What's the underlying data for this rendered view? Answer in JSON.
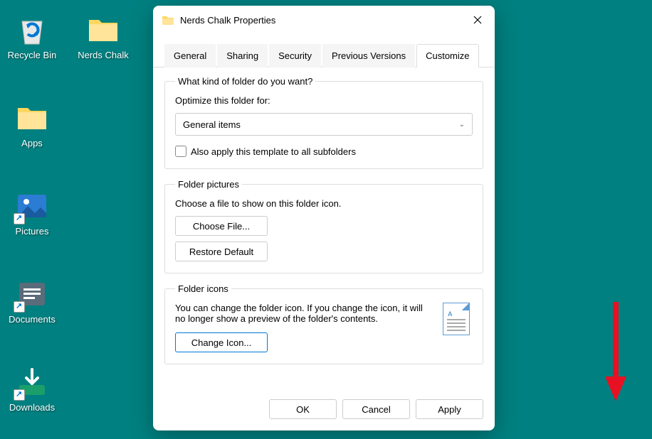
{
  "desktop": {
    "icons": [
      {
        "label": "Recycle Bin",
        "type": "recycle"
      },
      {
        "label": "Nerds Chalk",
        "type": "folder"
      },
      {
        "label": "Apps",
        "type": "folder"
      },
      {
        "label": "Pictures",
        "type": "pictures"
      },
      {
        "label": "Documents",
        "type": "documents"
      },
      {
        "label": "Downloads",
        "type": "downloads"
      }
    ]
  },
  "dialog": {
    "title": "Nerds Chalk Properties",
    "tabs": [
      "General",
      "Sharing",
      "Security",
      "Previous Versions",
      "Customize"
    ],
    "activeTab": "Customize",
    "section1": {
      "legend": "What kind of folder do you want?",
      "label": "Optimize this folder for:",
      "dropdownValue": "General items",
      "checkboxLabel": "Also apply this template to all subfolders"
    },
    "section2": {
      "legend": "Folder pictures",
      "text": "Choose a file to show on this folder icon.",
      "btn1": "Choose File...",
      "btn2": "Restore Default"
    },
    "section3": {
      "legend": "Folder icons",
      "text": "You can change the folder icon. If you change the icon, it will no longer show a preview of the folder's contents.",
      "btn": "Change Icon..."
    },
    "buttons": {
      "ok": "OK",
      "cancel": "Cancel",
      "apply": "Apply"
    }
  }
}
